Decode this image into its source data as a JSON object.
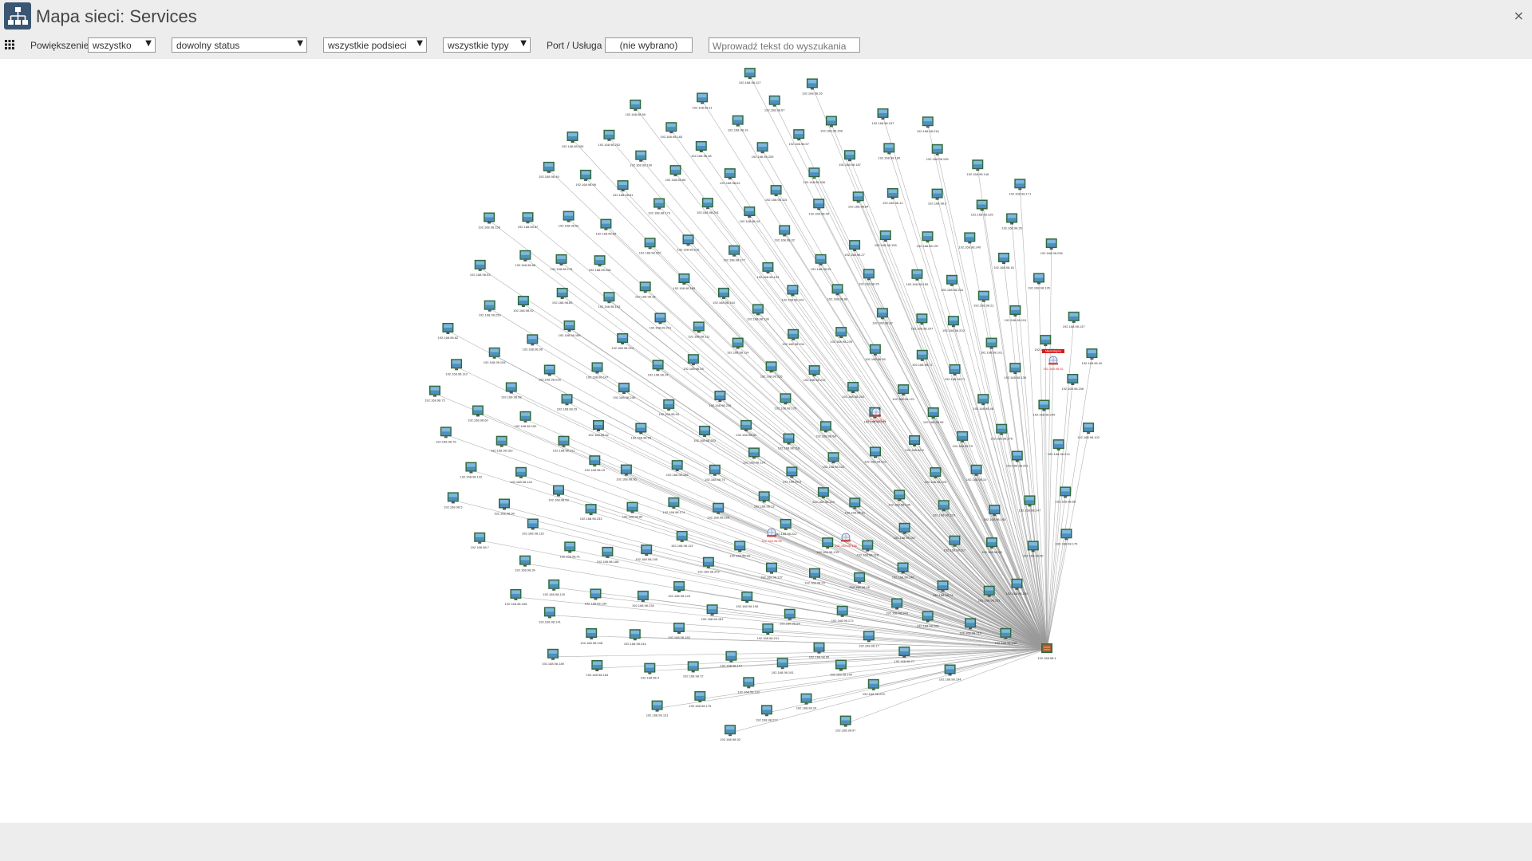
{
  "window": {
    "title": "Mapa sieci: Services",
    "app_icon": "network-map-icon",
    "close_icon": "close-icon",
    "close_glyph": "×"
  },
  "toolbar": {
    "menu_icon": "grid-menu-icon",
    "zoom_label": "Powiększenie",
    "zoom_value": "wszystko",
    "status_value": "dowolny status",
    "subnet_value": "wszystkie podsieci",
    "type_value": "wszystkie typy",
    "port_label": "Port / Usługa",
    "port_value": "(nie wybrano)",
    "search_placeholder": "Wprowadź tekst do wyszukania",
    "dropdown_glyph": "▼"
  },
  "colors": {
    "background": "#ededed",
    "map_background": "#ffffff",
    "edge": "#9a9a9a",
    "node_frame": "#2f6a3f",
    "node_fill": "#7fb8dc",
    "alert_label": "#e03030",
    "alert_tag": "#d41c1c",
    "router": "#b05a2a"
  },
  "map": {
    "hub_label": "192.168.98.1",
    "hub_icon": "router-icon",
    "host_icon": "monitor-icon",
    "alert_icon": "globe-warning-icon",
    "node_label_prefix": "192.168.98.",
    "nodes": [
      {
        "label": "192.168.98.170"
      },
      {
        "label": "192.168.98.90"
      },
      {
        "label": "192.168.98.215"
      },
      {
        "label": "192.168.98.118"
      },
      {
        "label": "192.168.98.226"
      },
      {
        "label": "192.168.98.212"
      },
      {
        "label": "192.168.98.124"
      },
      {
        "label": "192.168.98.114"
      },
      {
        "label": "192.168.98.68"
      },
      {
        "label": "192.168.98.203"
      },
      {
        "label": "192.168.98.234"
      },
      {
        "label": "192.168.98.6"
      },
      {
        "label": "192.168.98.45"
      },
      {
        "label": "192.168.98.250"
      },
      {
        "label": "192.168.98.75"
      },
      {
        "label": "192.168.98.136"
      },
      {
        "label": "192.168.98.122"
      },
      {
        "label": "192.168.98.94"
      },
      {
        "label": "192.168.98.239"
      },
      {
        "label": "192.168.98.13"
      },
      {
        "label": "192.168.98.111"
      },
      {
        "label": "192.168.98.161"
      },
      {
        "label": "192.168.98.166"
      },
      {
        "label": "192.168.98.104"
      },
      {
        "label": "192.168.98.149"
      },
      {
        "label": "192.168.98.14"
      },
      {
        "label": "192.168.98.36"
      },
      {
        "label": "192.168.98.129"
      },
      {
        "label": "192.168.98.164"
      },
      {
        "label": "192.168.98.223"
      },
      {
        "label": "192.168.98.93"
      },
      {
        "label": "192.168.98.86"
      },
      {
        "label": "192.168.98.222"
      },
      {
        "label": "192.168.98.221"
      },
      {
        "label": "192.168.98.121"
      },
      {
        "label": "192.168.98.174"
      },
      {
        "label": "192.168.98.193"
      },
      {
        "label": "192.168.98.31"
      },
      {
        "label": "192.168.98.246"
      },
      {
        "label": "192.168.98.32"
      },
      {
        "label": "192.168.98.20"
      },
      {
        "label": "192.168.98.185"
      },
      {
        "label": "192.168.98.9"
      },
      {
        "label": "192.168.98.36"
      },
      {
        "label": "192.168.98.99"
      },
      {
        "label": "192.168.98.133"
      },
      {
        "label": "192.168.98.224"
      },
      {
        "label": "192.168.98.71"
      },
      {
        "label": "192.168.98.113"
      },
      {
        "label": "192.168.98.177"
      },
      {
        "label": "192.168.98.135"
      },
      {
        "label": "192.168.98.42"
      },
      {
        "label": "192.168.98.25"
      },
      {
        "label": "192.168.98.237"
      },
      {
        "label": "192.168.98.18"
      },
      {
        "label": "192.168.98.95"
      },
      {
        "label": "192.168.98.89"
      },
      {
        "label": "192.168.98.32"
      },
      {
        "label": "192.168.98.218"
      },
      {
        "label": "192.168.98.147"
      },
      {
        "label": "192.168.98.207"
      },
      {
        "label": "192.168.98.242"
      },
      {
        "label": "192.168.98.210"
      },
      {
        "label": "192.168.98.225"
      },
      {
        "label": "192.168.98.15"
      },
      {
        "label": "192.168.98.27"
      },
      {
        "label": "192.168.98.23"
      },
      {
        "label": "192.168.98.153"
      },
      {
        "label": "192.168.98.71"
      },
      {
        "label": "192.168.98.245"
      },
      {
        "label": "192.168.98.44"
      },
      {
        "label": "192.168.98.167"
      },
      {
        "label": "192.168.98.29"
      },
      {
        "label": "192.168.98.159"
      },
      {
        "label": "192.168.98.198"
      },
      {
        "label": "192.168.98.220"
      },
      {
        "label": "192.168.98.79"
      },
      {
        "label": "192.168.98.233"
      },
      {
        "label": "192.168.98.48"
      },
      {
        "label": "192.168.98.28"
      },
      {
        "label": "192.168.98.169"
      },
      {
        "label": "192.168.98.202"
      },
      {
        "label": "192.168.98.143"
      },
      {
        "label": "192.168.98.251"
      },
      {
        "label": "192.168.98.128"
      },
      {
        "label": "192.168.98.211"
      },
      {
        "label": "192.168.98.155"
      },
      {
        "label": "192.168.98.64"
      },
      {
        "label": "192.168.98.208"
      },
      {
        "label": "192.168.98.46"
      },
      {
        "label": "192.168.98.188"
      },
      {
        "label": "192.168.98.115"
      },
      {
        "label": "192.168.98.142"
      },
      {
        "label": "192.168.98.228"
      },
      {
        "label": "192.168.98.254"
      },
      {
        "label": "192.168.98.181"
      },
      {
        "label": "192.168.98.173"
      },
      {
        "label": "192.168.98.10"
      },
      {
        "label": "192.168.98.63"
      },
      {
        "label": "192.168.98.84"
      },
      {
        "label": "192.168.98.172"
      },
      {
        "label": "192.168.98.85"
      },
      {
        "label": "192.168.98.101"
      },
      {
        "label": "192.168.98.230"
      },
      {
        "label": "192.168.98.62"
      },
      {
        "label": "192.168.98.117"
      },
      {
        "label": "192.168.98.152"
      },
      {
        "label": "192.168.98.197"
      },
      {
        "label": "192.168.98.241"
      },
      {
        "label": "192.168.98.83"
      },
      {
        "label": "192.168.98.176"
      },
      {
        "label": "192.168.98.41"
      },
      {
        "label": "192.168.98.236"
      },
      {
        "label": "192.168.98.243"
      },
      {
        "label": "192.168.98.96"
      },
      {
        "label": "192.168.98.21"
      },
      {
        "label": "192.168.98.163"
      },
      {
        "label": "192.168.98.65"
      },
      {
        "label": "192.168.98.150"
      },
      {
        "label": "192.168.98.144"
      },
      {
        "label": "192.168.98.12"
      },
      {
        "label": "192.168.98.55"
      },
      {
        "label": "192.168.98.178"
      },
      {
        "label": "192.168.98.139"
      },
      {
        "label": "192.168.98.190"
      },
      {
        "label": "192.168.98.205"
      },
      {
        "label": "192.168.98.74"
      },
      {
        "label": "192.168.98.58"
      },
      {
        "label": "192.168.98.240"
      },
      {
        "label": "192.168.98.107"
      },
      {
        "label": "192.168.98.81"
      },
      {
        "label": "192.168.98.201"
      },
      {
        "label": "192.168.98.116"
      },
      {
        "label": "192.168.98.187"
      },
      {
        "label": "192.168.98.17"
      },
      {
        "label": "192.168.98.92"
      },
      {
        "label": "192.168.98.119"
      },
      {
        "label": "192.168.98.244"
      },
      {
        "label": "192.168.98.38"
      },
      {
        "label": "192.168.98.80"
      },
      {
        "label": "192.168.98.162"
      },
      {
        "label": "192.168.98.3"
      },
      {
        "label": "192.168.98.191"
      },
      {
        "label": "192.168.98.52"
      },
      {
        "label": "192.168.98.249"
      },
      {
        "label": "192.168.98.120"
      },
      {
        "label": "192.168.98.57"
      },
      {
        "label": "192.168.98.106"
      },
      {
        "label": "192.168.98.154"
      },
      {
        "label": "192.168.98.16"
      },
      {
        "label": "192.168.98.72"
      },
      {
        "label": "192.168.98.199"
      },
      {
        "label": "192.168.98.247"
      },
      {
        "label": "192.168.98.34"
      },
      {
        "label": "192.168.98.180"
      },
      {
        "label": "192.168.98.145"
      },
      {
        "label": "192.168.98.66"
      },
      {
        "label": "192.168.98.214"
      },
      {
        "label": "192.168.98.108"
      },
      {
        "label": "192.168.98.19"
      },
      {
        "label": "192.168.98.231"
      },
      {
        "label": "192.168.98.60"
      },
      {
        "label": "192.168.98.125"
      },
      {
        "label": "192.168.98.192"
      },
      {
        "label": "192.168.98.98"
      },
      {
        "label": "192.168.98.213"
      },
      {
        "label": "192.168.98.39"
      },
      {
        "label": "192.168.98.158"
      },
      {
        "label": "192.168.98.77"
      },
      {
        "label": "192.168.98.253"
      },
      {
        "label": "192.168.98.126"
      },
      {
        "label": "192.168.98.4"
      },
      {
        "label": "192.168.98.183"
      },
      {
        "label": "192.168.98.50"
      },
      {
        "label": "192.168.98.132"
      },
      {
        "label": "192.168.98.195"
      },
      {
        "label": "192.168.98.24"
      },
      {
        "label": "192.168.98.87"
      },
      {
        "label": "192.168.98.206"
      },
      {
        "label": "192.168.98.141"
      },
      {
        "label": "192.168.98.67"
      },
      {
        "label": "192.168.98.219"
      },
      {
        "label": "192.168.98.110"
      },
      {
        "label": "192.168.98.35"
      },
      {
        "label": "192.168.98.175"
      },
      {
        "label": "192.168.98.252"
      },
      {
        "label": "192.168.98.88"
      },
      {
        "label": "192.168.98.7"
      },
      {
        "label": "192.168.98.157"
      },
      {
        "label": "192.168.98.229"
      },
      {
        "label": "192.168.98.53"
      },
      {
        "label": "192.168.98.137"
      },
      {
        "label": "192.168.98.184"
      },
      {
        "label": "192.168.98.11"
      },
      {
        "label": "192.168.98.200"
      },
      {
        "label": "192.168.98.76"
      },
      {
        "label": "192.168.98.146"
      },
      {
        "label": "192.168.98.227"
      },
      {
        "label": "192.168.98.49"
      },
      {
        "label": "192.168.98.102"
      },
      {
        "label": "192.168.98.168"
      },
      {
        "label": "192.168.98.26"
      },
      {
        "label": "192.168.98.194"
      },
      {
        "label": "192.168.98.82"
      },
      {
        "label": "192.168.98.238"
      },
      {
        "label": "192.168.98.131"
      },
      {
        "label": "192.168.98.59"
      },
      {
        "label": "192.168.98.179"
      },
      {
        "label": "192.168.98.5"
      },
      {
        "label": "192.168.98.216"
      },
      {
        "label": "192.168.98.97"
      },
      {
        "label": "192.168.98.156"
      },
      {
        "label": "192.168.98.40"
      },
      {
        "label": "192.168.98.189"
      },
      {
        "label": "192.168.98.127"
      },
      {
        "label": "192.168.98.248"
      },
      {
        "label": "192.168.98.73"
      },
      {
        "label": "192.168.98.171"
      },
      {
        "label": "192.168.98.30"
      },
      {
        "label": "192.168.98.209"
      }
    ],
    "alerts": [
      {
        "label": "192.168.98.91"
      },
      {
        "label": "192.168.98.56"
      },
      {
        "label": "192.168.98.138"
      },
      {
        "label": "192.168.98.61",
        "tag": "Niedostępny"
      }
    ]
  }
}
